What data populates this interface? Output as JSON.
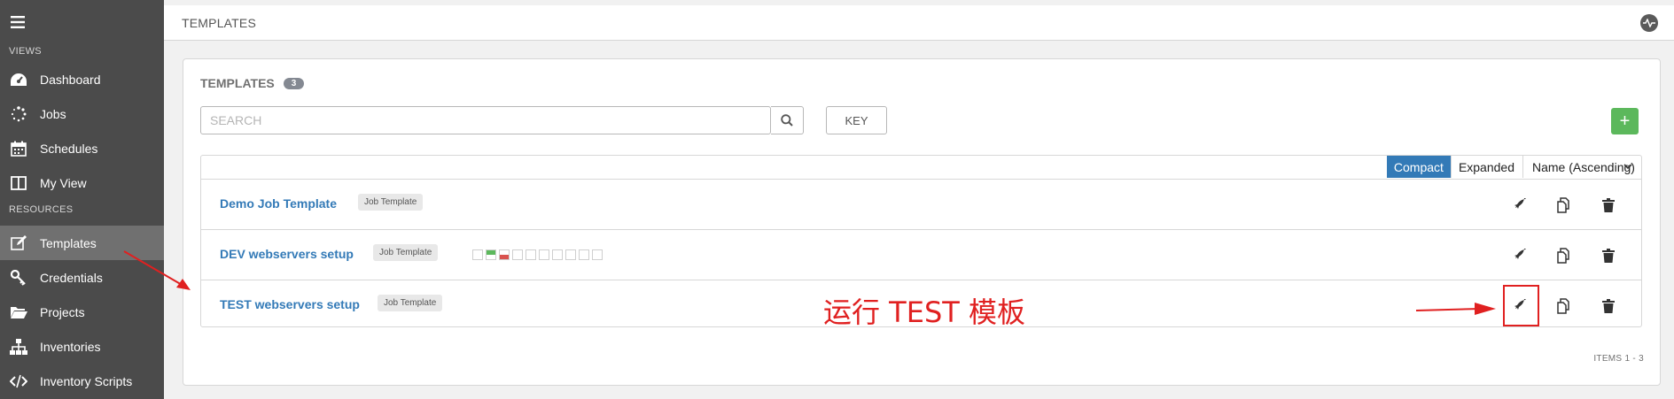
{
  "sidebar": {
    "sections": {
      "views": "VIEWS",
      "resources": "RESOURCES"
    },
    "views_items": [
      {
        "label": "Dashboard",
        "icon": "dashboard-icon"
      },
      {
        "label": "Jobs",
        "icon": "jobs-icon"
      },
      {
        "label": "Schedules",
        "icon": "calendar-icon"
      },
      {
        "label": "My View",
        "icon": "columns-icon"
      }
    ],
    "resources_items": [
      {
        "label": "Templates",
        "icon": "edit-icon",
        "active": true
      },
      {
        "label": "Credentials",
        "icon": "key-icon"
      },
      {
        "label": "Projects",
        "icon": "folder-icon"
      },
      {
        "label": "Inventories",
        "icon": "sitemap-icon"
      },
      {
        "label": "Inventory Scripts",
        "icon": "code-icon"
      }
    ]
  },
  "header": {
    "title": "TEMPLATES"
  },
  "panel": {
    "title": "TEMPLATES",
    "count": "3",
    "search_placeholder": "SEARCH",
    "key_label": "KEY",
    "add_label": "+",
    "view_compact": "Compact",
    "view_expanded": "Expanded",
    "sort_label": "Name (Ascending)",
    "items_label": "ITEMS  1 - 3"
  },
  "templates": [
    {
      "name": "Demo Job Template",
      "type": "Job Template"
    },
    {
      "name": "DEV webservers setup",
      "type": "Job Template",
      "recent_jobs": [
        "empty",
        "success",
        "failed",
        "empty",
        "empty",
        "empty",
        "empty",
        "empty",
        "empty",
        "empty"
      ]
    },
    {
      "name": "TEST webservers setup",
      "type": "Job Template"
    }
  ],
  "annotation": {
    "text": "运行 TEST 模板",
    "color": "#e02020"
  },
  "colors": {
    "accent": "#337ab7",
    "add": "#5cb85c",
    "sidebar": "#4b4b4b",
    "success": "#5cb85c",
    "failed": "#d9534f"
  }
}
